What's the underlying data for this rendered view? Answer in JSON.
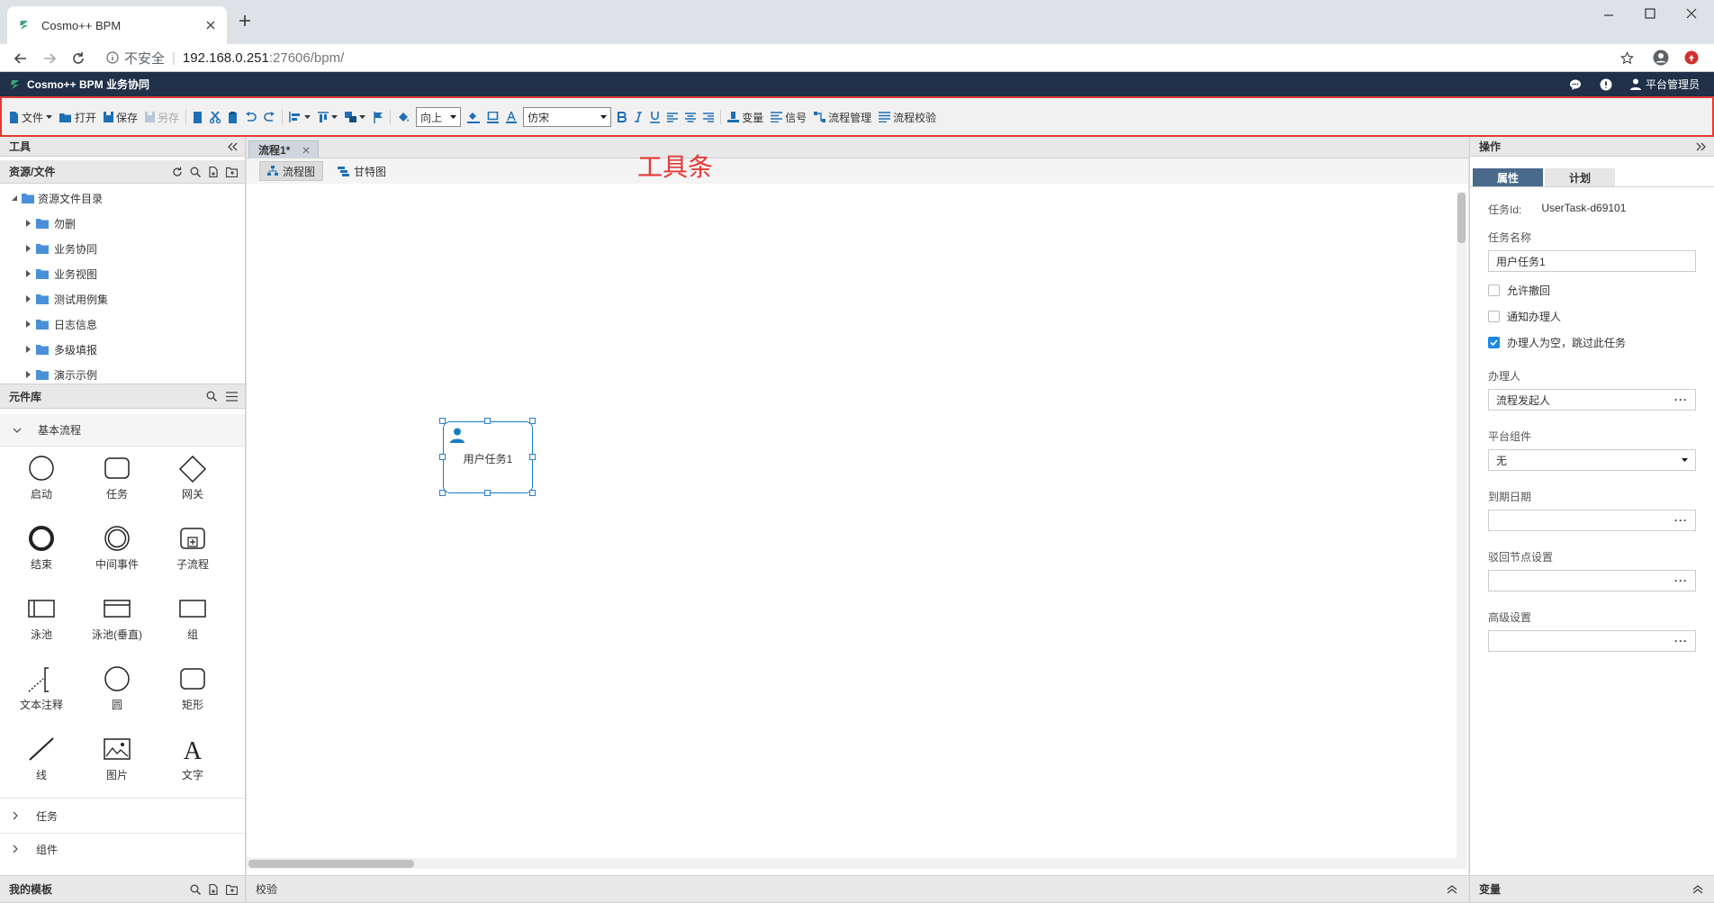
{
  "browser": {
    "tab_title": "Cosmo++ BPM",
    "security_label": "不安全",
    "url_host": "192.168.0.251",
    "url_port_path": ":27606/bpm/"
  },
  "app": {
    "title": "Cosmo++ BPM 业务协同",
    "user": "平台管理员"
  },
  "toolbar": {
    "file": "文件",
    "open": "打开",
    "save": "保存",
    "save_as": "另存",
    "direction": "向上",
    "font": "仿宋",
    "variable": "变量",
    "signal": "信号",
    "process_manage": "流程管理",
    "process_check": "流程校验"
  },
  "annotation": {
    "toolbar_label": "工具条",
    "color": "#e53935"
  },
  "left": {
    "tools_title": "工具",
    "resources_title": "资源/文件",
    "tree_root": "资源文件目录",
    "tree_items": [
      "勿删",
      "业务协同",
      "业务视图",
      "测试用例集",
      "日志信息",
      "多级填报",
      "演示示例"
    ],
    "library_title": "元件库",
    "basic_group": "基本流程",
    "components": [
      "启动",
      "任务",
      "网关",
      "结束",
      "中间事件",
      "子流程",
      "泳池",
      "泳池(垂直)",
      "组",
      "文本注释",
      "圆",
      "矩形",
      "线",
      "图片",
      "文字"
    ],
    "task_group": "任务",
    "component_group": "组件",
    "templates_title": "我的模板"
  },
  "center": {
    "doc_tab": "流程1*",
    "view_flow": "流程图",
    "view_gantt": "甘特图",
    "node_label": "用户任务1",
    "bottom_title": "校验",
    "accent": "#1a7fc1"
  },
  "right": {
    "ops_title": "操作",
    "tab_props": "属性",
    "tab_plan": "计划",
    "task_id_label": "任务Id:",
    "task_id_value": "UserTask-d69101",
    "task_name_label": "任务名称",
    "task_name_value": "用户任务1",
    "allow_withdraw": "允许撤回",
    "notify_handler": "通知办理人",
    "skip_empty": "办理人为空，跳过此任务",
    "handler_label": "办理人",
    "handler_value": "流程发起人",
    "platform_label": "平台组件",
    "platform_value": "无",
    "due_label": "到期日期",
    "reject_label": "驳回节点设置",
    "advanced_label": "高级设置",
    "variables_title": "变量"
  }
}
